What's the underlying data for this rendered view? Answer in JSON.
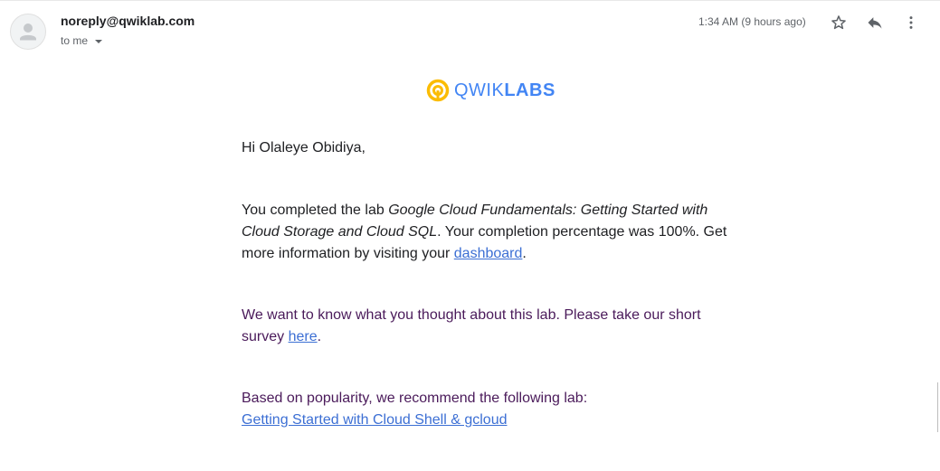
{
  "header": {
    "sender": "noreply@qwiklab.com",
    "recipient_label": "to me",
    "timestamp": "1:34 AM (9 hours ago)",
    "icons": {
      "avatar": "person-icon",
      "star": "star-icon",
      "reply": "reply-icon",
      "more": "more-vert-icon"
    }
  },
  "logo": {
    "text_light": "QWIK",
    "text_bold": "LABS",
    "colors": {
      "ring": "#fbbc04",
      "text": "#4285f4"
    }
  },
  "email": {
    "greeting": "Hi Olaleye Obidiya,",
    "completion": {
      "prefix": "You completed the lab ",
      "lab_name": "Google Cloud Fundamentals: Getting Started with Cloud Storage and Cloud SQL",
      "middle": ". Your completion percentage was 100%. Get more information by visiting your ",
      "link": "dashboard",
      "suffix": "."
    },
    "survey": {
      "prefix": "We want to know what you thought about this lab. Please take our short survey ",
      "link": "here",
      "suffix": "."
    },
    "recommend": {
      "text": "Based on popularity, we recommend the following lab:",
      "link": "Getting Started with Cloud Shell & gcloud"
    }
  },
  "colors": {
    "link": "#3c6fd4",
    "purple_text": "#4a1a5a",
    "body_text": "#202124",
    "muted": "#5f6368"
  }
}
